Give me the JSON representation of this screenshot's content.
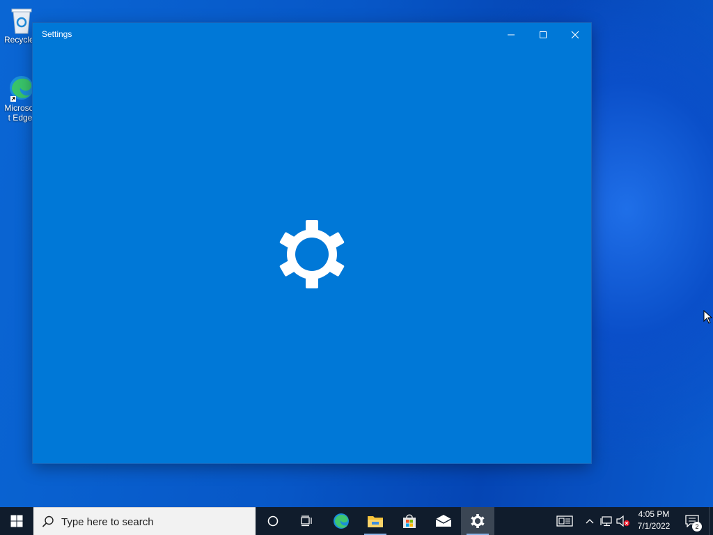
{
  "desktop": {
    "icons": [
      {
        "label": "Recycle Bin"
      },
      {
        "label": "Microsoft Edge"
      }
    ]
  },
  "window": {
    "title": "Settings",
    "controls": {
      "minimize": "minimize-icon",
      "maximize": "maximize-icon",
      "close": "close-icon"
    },
    "splash_icon": "gear-icon",
    "background": "#0078d7"
  },
  "taskbar": {
    "search_placeholder": "Type here to search",
    "apps": [
      "start-icon",
      "cortana-icon",
      "task-view-icon",
      "edge-icon",
      "file-explorer-icon",
      "store-icon",
      "mail-icon",
      "settings-icon"
    ],
    "active_app": "Settings",
    "clock": {
      "time": "4:05 PM",
      "date": "7/1/2022"
    },
    "notification_count": "2"
  }
}
